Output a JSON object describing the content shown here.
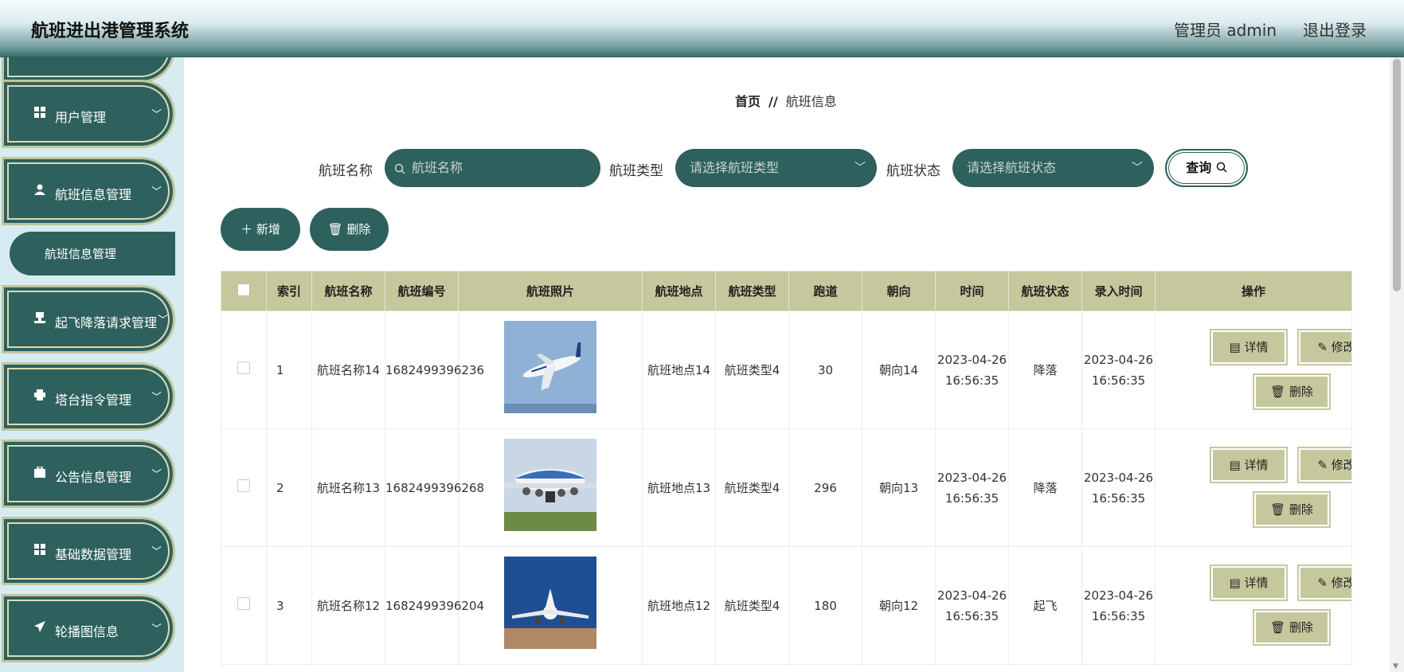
{
  "header": {
    "title": "航班进出港管理系统",
    "user": "管理员 admin",
    "logout": "退出登录"
  },
  "sidebar": {
    "items": [
      {
        "label": "用户管理",
        "icon": "grid-icon"
      },
      {
        "label": "航班信息管理",
        "icon": "user-icon"
      },
      {
        "label": "起飞降落请求管理",
        "icon": "stamp-icon"
      },
      {
        "label": "塔台指令管理",
        "icon": "printer-icon"
      },
      {
        "label": "公告信息管理",
        "icon": "briefcase-icon"
      },
      {
        "label": "基础数据管理",
        "icon": "grid-icon"
      },
      {
        "label": "轮播图信息",
        "icon": "send-icon"
      }
    ],
    "sub_item": "航班信息管理"
  },
  "breadcrumb": {
    "home": "首页",
    "sep": "//",
    "current": "航班信息"
  },
  "search": {
    "name_label": "航班名称",
    "name_placeholder": "航班名称",
    "type_label": "航班类型",
    "type_placeholder": "请选择航班类型",
    "status_label": "航班状态",
    "status_placeholder": "请选择航班状态",
    "query": "查询"
  },
  "actions": {
    "add": "新增",
    "delete": "删除"
  },
  "table": {
    "headers": [
      "索引",
      "航班名称",
      "航班编号",
      "航班照片",
      "航班地点",
      "航班类型",
      "跑道",
      "朝向",
      "时间",
      "航班状态",
      "录入时间",
      "操作"
    ],
    "rows": [
      {
        "index": "1",
        "name": "航班名称14",
        "code": "1682499396236",
        "location": "航班地点14",
        "type": "航班类型4",
        "runway": "30",
        "direction": "朝向14",
        "time": "2023-04-26 16:56:35",
        "status": "降落",
        "created": "2023-04-26 16:56:35",
        "photo": "plane-takeoff-sky"
      },
      {
        "index": "2",
        "name": "航班名称13",
        "code": "1682499396268",
        "location": "航班地点13",
        "type": "航班类型4",
        "runway": "296",
        "direction": "朝向13",
        "time": "2023-04-26 16:56:35",
        "status": "降落",
        "created": "2023-04-26 16:56:35",
        "photo": "plane-landing-grass"
      },
      {
        "index": "3",
        "name": "航班名称12",
        "code": "1682499396204",
        "location": "航班地点12",
        "type": "航班类型4",
        "runway": "180",
        "direction": "朝向12",
        "time": "2023-04-26 16:56:35",
        "status": "起飞",
        "created": "2023-04-26 16:56:35",
        "photo": "plane-front-runway"
      }
    ],
    "ops": {
      "detail": "详情",
      "edit": "修改",
      "delete": "删除"
    }
  },
  "colors": {
    "primary": "#2e615d",
    "accent": "#c5c89c",
    "sidebar_bg": "#d7ebf2"
  }
}
